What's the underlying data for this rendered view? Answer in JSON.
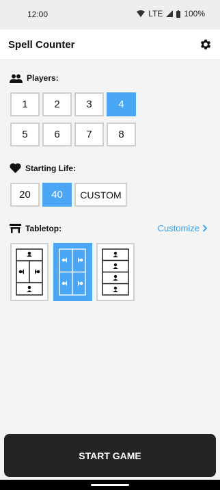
{
  "status": {
    "time": "12:00",
    "network": "LTE",
    "battery": "100%"
  },
  "app": {
    "title": "Spell Counter"
  },
  "players": {
    "label": "Players:",
    "options": [
      "1",
      "2",
      "3",
      "4",
      "5",
      "6",
      "7",
      "8"
    ],
    "selected": "4"
  },
  "life": {
    "label": "Starting Life:",
    "options": [
      "20",
      "40",
      "CUSTOM"
    ],
    "selected": "40"
  },
  "tabletop": {
    "label": "Tabletop:",
    "customize_label": "Customize",
    "selected_index": 1
  },
  "start_label": "START GAME",
  "colors": {
    "accent": "#4aa7f5",
    "link": "#2fa0f0",
    "button_dark": "#242424"
  }
}
